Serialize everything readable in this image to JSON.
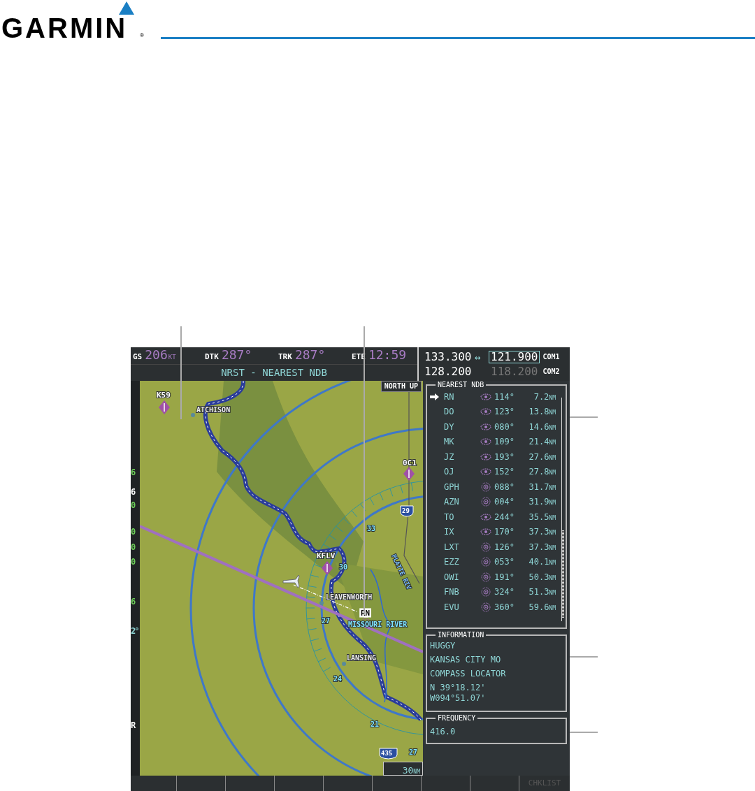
{
  "header": {
    "brand": "GARMIN",
    "registered_mark": "®"
  },
  "top_bar": {
    "fields": [
      {
        "label": "GS",
        "value": "206",
        "unit": "KT"
      },
      {
        "label": "DTK",
        "value": "287°"
      },
      {
        "label": "TRK",
        "value": "287°"
      },
      {
        "label": "ETE",
        "value": "12:59"
      }
    ],
    "page_title": "NRST - NEAREST NDB"
  },
  "com_radios": [
    {
      "name": "COM1",
      "active": "133.300",
      "swap_arrow": "↔",
      "standby": "121.900",
      "tuning_box": true,
      "dimmed": false
    },
    {
      "name": "COM2",
      "active": "128.200",
      "standby": "118.200",
      "tuning_box": false,
      "dimmed": true
    }
  ],
  "left_tape_fragments": [
    {
      "text": "6",
      "color": "#6ecf5a"
    },
    {
      "text": "6",
      "color": "#ffffff"
    },
    {
      "text": "0",
      "color": "#6ecf5a"
    },
    {
      "text": "0",
      "color": "#6ecf5a"
    },
    {
      "text": "0",
      "color": "#6ecf5a"
    },
    {
      "text": "0",
      "color": "#6ecf5a"
    },
    {
      "text": "6",
      "color": "#6ecf5a"
    },
    {
      "text": "2°",
      "color": "#8fd6d6"
    },
    {
      "text": "R",
      "color": "#ffffff"
    }
  ],
  "map": {
    "orientation": "NORTH UP",
    "range": "30",
    "range_unit": "NM",
    "labels": [
      {
        "text": "K59",
        "kind": "airport"
      },
      {
        "text": "ATCHISON",
        "kind": "city"
      },
      {
        "text": "0C1",
        "kind": "airport"
      },
      {
        "text": "29",
        "kind": "highway"
      },
      {
        "text": "33",
        "kind": "altitude"
      },
      {
        "text": "PLATTE RIV",
        "kind": "river"
      },
      {
        "text": "KFLV",
        "kind": "airport"
      },
      {
        "text": "30",
        "kind": "altitude"
      },
      {
        "text": "LEAVENWORTH",
        "kind": "city"
      },
      {
        "text": "RN",
        "kind": "ndb_tag"
      },
      {
        "text": "27",
        "kind": "altitude"
      },
      {
        "text": "MISSOURI RIVER",
        "kind": "ndb_name"
      },
      {
        "text": "LANSING",
        "kind": "city"
      },
      {
        "text": "24",
        "kind": "altitude"
      },
      {
        "text": "21",
        "kind": "altitude"
      },
      {
        "text": "435",
        "kind": "highway"
      },
      {
        "text": "27",
        "kind": "altitude"
      }
    ]
  },
  "nearest_ndb": {
    "title": "NEAREST NDB",
    "rows": [
      {
        "ident": "RN",
        "kind": "locator",
        "bearing": "114°",
        "distance": "7.2",
        "unit": "NM",
        "selected": true
      },
      {
        "ident": "DO",
        "kind": "locator",
        "bearing": "123°",
        "distance": "13.8",
        "unit": "NM",
        "selected": false
      },
      {
        "ident": "DY",
        "kind": "locator",
        "bearing": "080°",
        "distance": "14.6",
        "unit": "NM",
        "selected": false
      },
      {
        "ident": "MK",
        "kind": "locator",
        "bearing": "109°",
        "distance": "21.4",
        "unit": "NM",
        "selected": false
      },
      {
        "ident": "JZ",
        "kind": "locator",
        "bearing": "193°",
        "distance": "27.6",
        "unit": "NM",
        "selected": false
      },
      {
        "ident": "OJ",
        "kind": "locator",
        "bearing": "152°",
        "distance": "27.8",
        "unit": "NM",
        "selected": false
      },
      {
        "ident": "GPH",
        "kind": "ndb",
        "bearing": "088°",
        "distance": "31.7",
        "unit": "NM",
        "selected": false
      },
      {
        "ident": "AZN",
        "kind": "ndb",
        "bearing": "004°",
        "distance": "31.9",
        "unit": "NM",
        "selected": false
      },
      {
        "ident": "TO",
        "kind": "locator",
        "bearing": "244°",
        "distance": "35.5",
        "unit": "NM",
        "selected": false
      },
      {
        "ident": "IX",
        "kind": "locator",
        "bearing": "170°",
        "distance": "37.3",
        "unit": "NM",
        "selected": false
      },
      {
        "ident": "LXT",
        "kind": "ndb",
        "bearing": "126°",
        "distance": "37.3",
        "unit": "NM",
        "selected": false
      },
      {
        "ident": "EZZ",
        "kind": "ndb",
        "bearing": "053°",
        "distance": "40.1",
        "unit": "NM",
        "selected": false
      },
      {
        "ident": "OWI",
        "kind": "ndb",
        "bearing": "191°",
        "distance": "50.3",
        "unit": "NM",
        "selected": false
      },
      {
        "ident": "FNB",
        "kind": "ndb",
        "bearing": "324°",
        "distance": "51.3",
        "unit": "NM",
        "selected": false
      },
      {
        "ident": "EVU",
        "kind": "ndb",
        "bearing": "360°",
        "distance": "59.6",
        "unit": "NM",
        "selected": false
      }
    ]
  },
  "information": {
    "title": "INFORMATION",
    "lines": [
      "HUGGY",
      "KANSAS CITY MO",
      "COMPASS LOCATOR"
    ],
    "latitude": "N 39°18.12'",
    "longitude": "W094°51.07'"
  },
  "frequency": {
    "title": "FREQUENCY",
    "value": "416.0"
  },
  "softkeys": [
    {
      "label": "CHKLIST",
      "disabled": true
    }
  ]
}
